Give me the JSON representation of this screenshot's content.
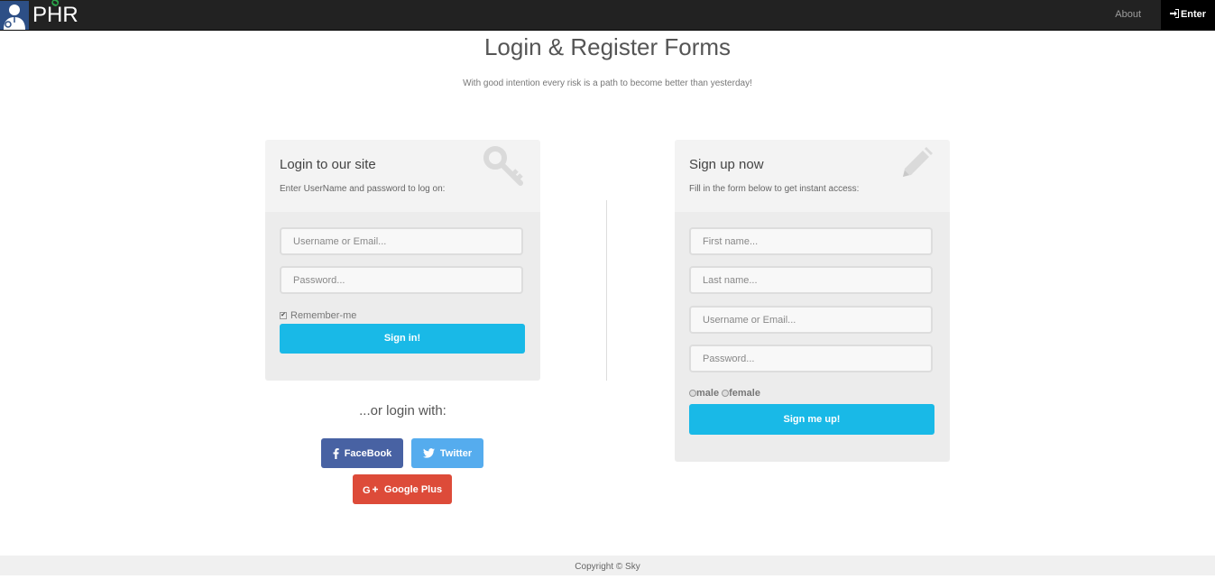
{
  "nav": {
    "brand": "PHR",
    "brand_sup": "on",
    "about": "About",
    "enter": "Enter"
  },
  "header": {
    "title": "Login & Register Forms",
    "subtitle": "With good intention every risk is a path to become better than yesterday!"
  },
  "login": {
    "title": "Login to our site",
    "description": "Enter UserName and password to log on:",
    "username_placeholder": "Username or Email...",
    "password_placeholder": "Password...",
    "remember": "Remember-me",
    "submit": "Sign in!"
  },
  "social": {
    "heading": "...or login with:",
    "facebook": "FaceBook",
    "twitter": "Twitter",
    "google": "Google Plus"
  },
  "signup": {
    "title": "Sign up now",
    "description": "Fill in the form below to get instant access:",
    "first_name_placeholder": "First name...",
    "last_name_placeholder": "Last name...",
    "username_placeholder": "Username or Email...",
    "password_placeholder": "Password...",
    "male": "male",
    "female": "female",
    "submit": "Sign me up!"
  },
  "footer": {
    "copyright": "Copyright © Sky"
  },
  "colors": {
    "primary": "#19b9e7",
    "facebook": "#4862a3",
    "twitter": "#55acee",
    "google": "#dd4b39",
    "navbar": "#222222"
  }
}
